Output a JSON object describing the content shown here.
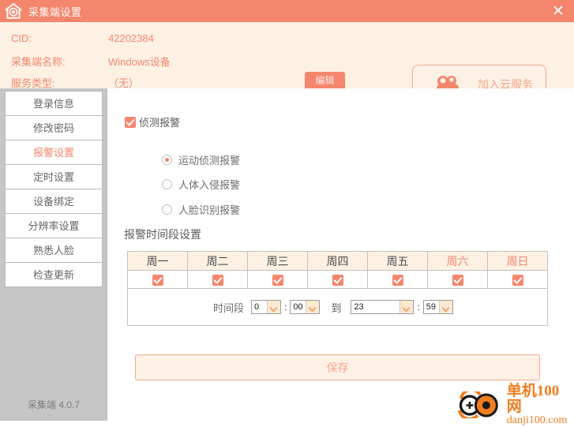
{
  "window": {
    "title": "采集端设置",
    "title_icon": "home-camera-icon",
    "close_label": "✕",
    "accent_color": "#f4866d",
    "header_bg": "#fcf1e3"
  },
  "info": {
    "rows": [
      {
        "label": "CID:",
        "value": "42202384"
      },
      {
        "label": "采集端名称:",
        "value": "Windows设备"
      },
      {
        "label": "服务类型:",
        "value": "（无）"
      }
    ],
    "edit_button": "编辑",
    "cloud_button": "加入云服务",
    "cloud_icon": "cloud-icon"
  },
  "sidebar": {
    "items": [
      {
        "label": "登录信息",
        "active": false
      },
      {
        "label": "修改密码",
        "active": false
      },
      {
        "label": "报警设置",
        "active": true
      },
      {
        "label": "定时设置",
        "active": false
      },
      {
        "label": "设备绑定",
        "active": false
      },
      {
        "label": "分辨率设置",
        "active": false
      },
      {
        "label": "熟悉人脸",
        "active": false
      },
      {
        "label": "检查更新",
        "active": false
      }
    ],
    "version": "采集端 4.0.7"
  },
  "main": {
    "detect_alarm": {
      "label": "侦测报警",
      "checked": true
    },
    "alarm_modes": [
      {
        "label": "运动侦测报警",
        "selected": true
      },
      {
        "label": "人体入侵报警",
        "selected": false
      },
      {
        "label": "人脸识别报警",
        "selected": false
      }
    ],
    "schedule_title": "报警时间段设置",
    "week_table": {
      "headers": [
        "周一",
        "周二",
        "周三",
        "周四",
        "周五",
        "周六",
        "周日"
      ],
      "weekend_flags": [
        false,
        false,
        false,
        false,
        false,
        true,
        true
      ],
      "checked": [
        true,
        true,
        true,
        true,
        true,
        true,
        true
      ]
    },
    "time_range": {
      "label": "时间段",
      "start_hour": "0",
      "start_minute": "00",
      "to_label": "到",
      "end_hour": "23",
      "end_minute": "59",
      "colon": ":"
    },
    "save_button": "保存"
  },
  "watermark": {
    "line1": "单机100网",
    "line2": "danji100.com"
  }
}
